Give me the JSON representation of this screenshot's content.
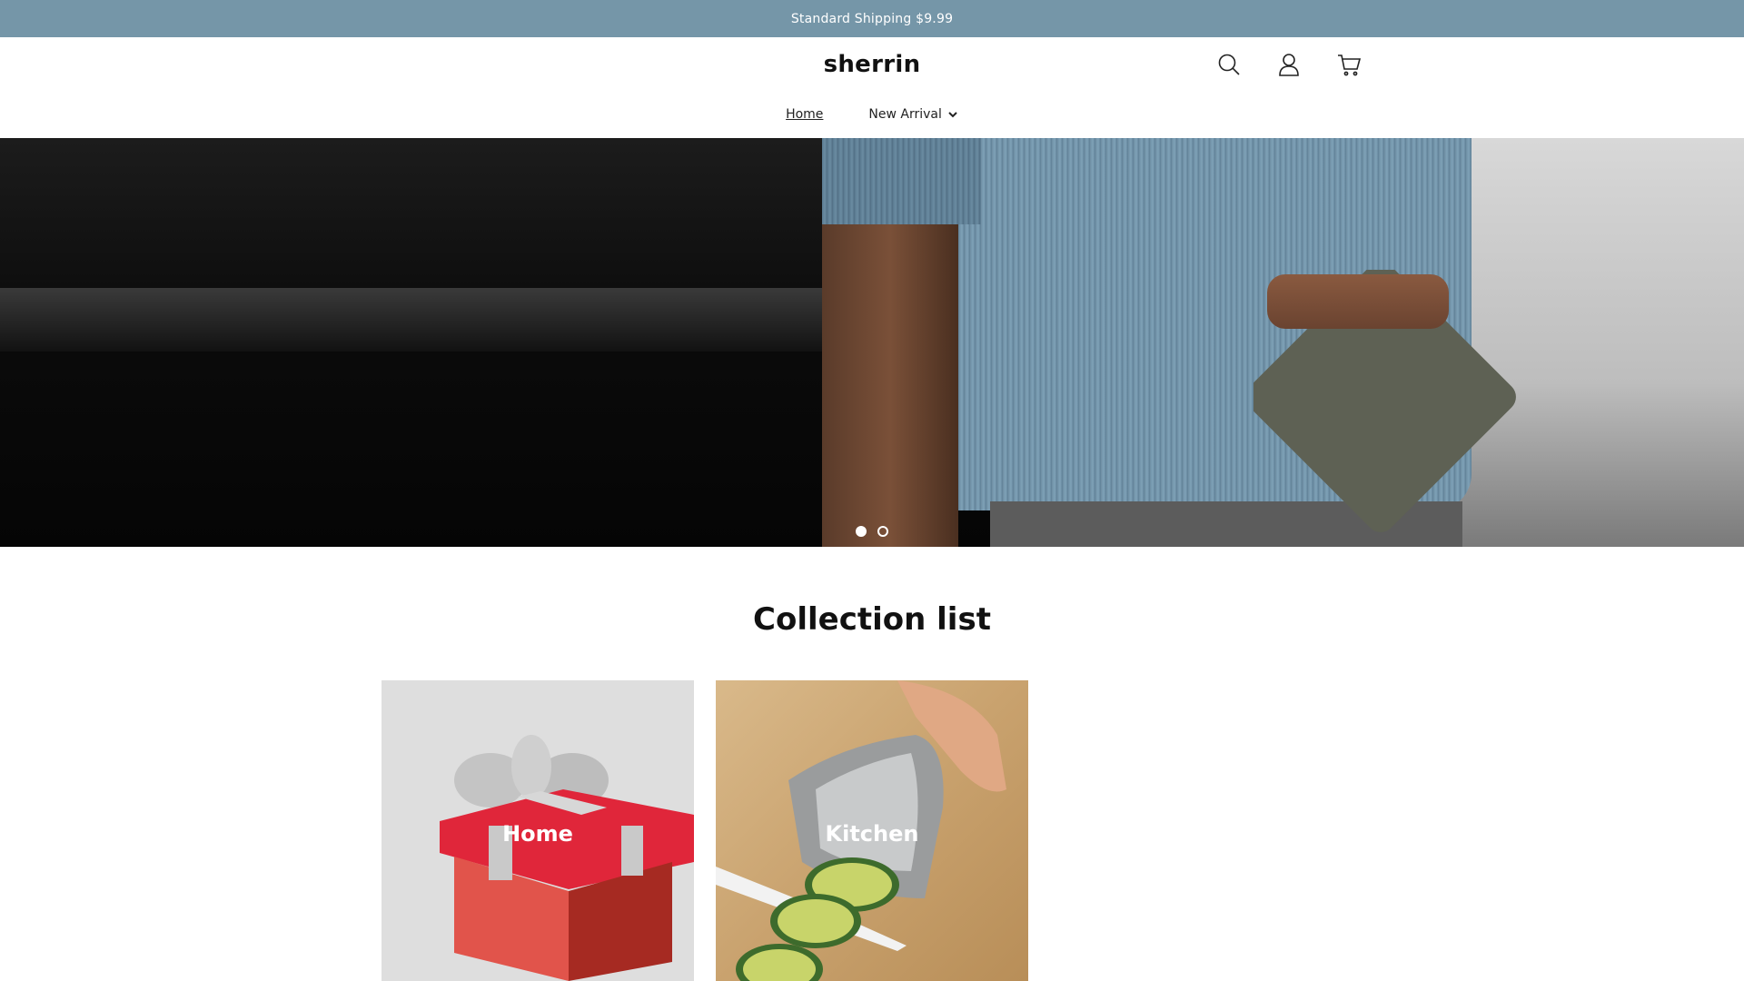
{
  "announcement": {
    "text": "Standard Shipping $9.99"
  },
  "header": {
    "logo": "sherrin",
    "icons": [
      "search-icon",
      "account-icon",
      "cart-icon"
    ]
  },
  "nav": {
    "items": [
      {
        "label": "Home",
        "active": true
      },
      {
        "label": "New Arrival",
        "dropdown": true
      }
    ]
  },
  "hero": {
    "slides_total": 2,
    "active_slide": 1
  },
  "collection": {
    "title": "Collection list",
    "cards": [
      {
        "label": "Home"
      },
      {
        "label": "Kitchen"
      }
    ]
  },
  "colors": {
    "announcement_bg": "#7596a8",
    "text": "#111111"
  }
}
